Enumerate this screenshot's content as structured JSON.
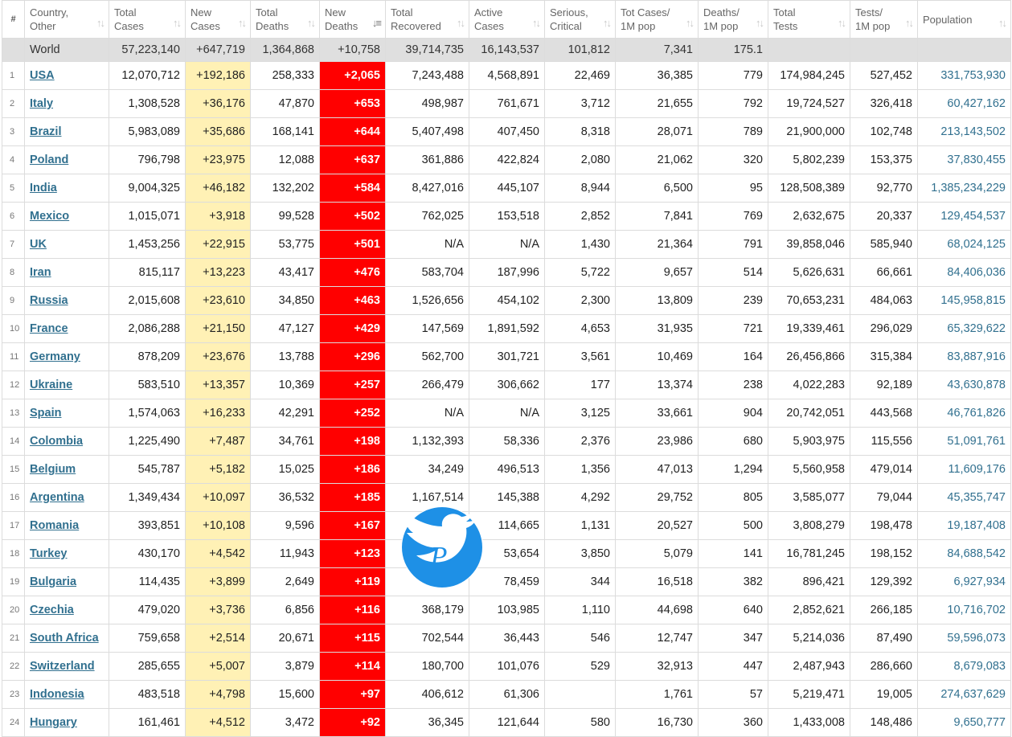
{
  "headers": [
    {
      "key": "num",
      "label": "#"
    },
    {
      "key": "country",
      "label": "Country,\nOther"
    },
    {
      "key": "total_cases",
      "label": "Total\nCases"
    },
    {
      "key": "new_cases",
      "label": "New\nCases"
    },
    {
      "key": "total_deaths",
      "label": "Total\nDeaths"
    },
    {
      "key": "new_deaths",
      "label": "New\nDeaths",
      "sorted": true
    },
    {
      "key": "total_recovered",
      "label": "Total\nRecovered"
    },
    {
      "key": "active_cases",
      "label": "Active\nCases"
    },
    {
      "key": "serious",
      "label": "Serious,\nCritical"
    },
    {
      "key": "cases_per_m",
      "label": "Tot Cases/\n1M pop"
    },
    {
      "key": "deaths_per_m",
      "label": "Deaths/\n1M pop"
    },
    {
      "key": "total_tests",
      "label": "Total\nTests"
    },
    {
      "key": "tests_per_m",
      "label": "Tests/\n1M pop"
    },
    {
      "key": "population",
      "label": "Population"
    }
  ],
  "world": [
    "World",
    "57,223,140",
    "+647,719",
    "1,364,868",
    "+10,758",
    "39,714,735",
    "16,143,537",
    "101,812",
    "7,341",
    "175.1",
    "",
    "",
    ""
  ],
  "rows": [
    [
      "1",
      "USA",
      "12,070,712",
      "+192,186",
      "258,333",
      "+2,065",
      "7,243,488",
      "4,568,891",
      "22,469",
      "36,385",
      "779",
      "174,984,245",
      "527,452",
      "331,753,930"
    ],
    [
      "2",
      "Italy",
      "1,308,528",
      "+36,176",
      "47,870",
      "+653",
      "498,987",
      "761,671",
      "3,712",
      "21,655",
      "792",
      "19,724,527",
      "326,418",
      "60,427,162"
    ],
    [
      "3",
      "Brazil",
      "5,983,089",
      "+35,686",
      "168,141",
      "+644",
      "5,407,498",
      "407,450",
      "8,318",
      "28,071",
      "789",
      "21,900,000",
      "102,748",
      "213,143,502"
    ],
    [
      "4",
      "Poland",
      "796,798",
      "+23,975",
      "12,088",
      "+637",
      "361,886",
      "422,824",
      "2,080",
      "21,062",
      "320",
      "5,802,239",
      "153,375",
      "37,830,455"
    ],
    [
      "5",
      "India",
      "9,004,325",
      "+46,182",
      "132,202",
      "+584",
      "8,427,016",
      "445,107",
      "8,944",
      "6,500",
      "95",
      "128,508,389",
      "92,770",
      "1,385,234,229"
    ],
    [
      "6",
      "Mexico",
      "1,015,071",
      "+3,918",
      "99,528",
      "+502",
      "762,025",
      "153,518",
      "2,852",
      "7,841",
      "769",
      "2,632,675",
      "20,337",
      "129,454,537"
    ],
    [
      "7",
      "UK",
      "1,453,256",
      "+22,915",
      "53,775",
      "+501",
      "N/A",
      "N/A",
      "1,430",
      "21,364",
      "791",
      "39,858,046",
      "585,940",
      "68,024,125"
    ],
    [
      "8",
      "Iran",
      "815,117",
      "+13,223",
      "43,417",
      "+476",
      "583,704",
      "187,996",
      "5,722",
      "9,657",
      "514",
      "5,626,631",
      "66,661",
      "84,406,036"
    ],
    [
      "9",
      "Russia",
      "2,015,608",
      "+23,610",
      "34,850",
      "+463",
      "1,526,656",
      "454,102",
      "2,300",
      "13,809",
      "239",
      "70,653,231",
      "484,063",
      "145,958,815"
    ],
    [
      "10",
      "France",
      "2,086,288",
      "+21,150",
      "47,127",
      "+429",
      "147,569",
      "1,891,592",
      "4,653",
      "31,935",
      "721",
      "19,339,461",
      "296,029",
      "65,329,622"
    ],
    [
      "11",
      "Germany",
      "878,209",
      "+23,676",
      "13,788",
      "+296",
      "562,700",
      "301,721",
      "3,561",
      "10,469",
      "164",
      "26,456,866",
      "315,384",
      "83,887,916"
    ],
    [
      "12",
      "Ukraine",
      "583,510",
      "+13,357",
      "10,369",
      "+257",
      "266,479",
      "306,662",
      "177",
      "13,374",
      "238",
      "4,022,283",
      "92,189",
      "43,630,878"
    ],
    [
      "13",
      "Spain",
      "1,574,063",
      "+16,233",
      "42,291",
      "+252",
      "N/A",
      "N/A",
      "3,125",
      "33,661",
      "904",
      "20,742,051",
      "443,568",
      "46,761,826"
    ],
    [
      "14",
      "Colombia",
      "1,225,490",
      "+7,487",
      "34,761",
      "+198",
      "1,132,393",
      "58,336",
      "2,376",
      "23,986",
      "680",
      "5,903,975",
      "115,556",
      "51,091,761"
    ],
    [
      "15",
      "Belgium",
      "545,787",
      "+5,182",
      "15,025",
      "+186",
      "34,249",
      "496,513",
      "1,356",
      "47,013",
      "1,294",
      "5,560,958",
      "479,014",
      "11,609,176"
    ],
    [
      "16",
      "Argentina",
      "1,349,434",
      "+10,097",
      "36,532",
      "+185",
      "1,167,514",
      "145,388",
      "4,292",
      "29,752",
      "805",
      "3,585,077",
      "79,044",
      "45,355,747"
    ],
    [
      "17",
      "Romania",
      "393,851",
      "+10,108",
      "9,596",
      "+167",
      "",
      "114,665",
      "1,131",
      "20,527",
      "500",
      "3,808,279",
      "198,478",
      "19,187,408"
    ],
    [
      "18",
      "Turkey",
      "430,170",
      "+4,542",
      "11,943",
      "+123",
      "",
      "53,654",
      "3,850",
      "5,079",
      "141",
      "16,781,245",
      "198,152",
      "84,688,542"
    ],
    [
      "19",
      "Bulgaria",
      "114,435",
      "+3,899",
      "2,649",
      "+119",
      "",
      "78,459",
      "344",
      "16,518",
      "382",
      "896,421",
      "129,392",
      "6,927,934"
    ],
    [
      "20",
      "Czechia",
      "479,020",
      "+3,736",
      "6,856",
      "+116",
      "368,179",
      "103,985",
      "1,110",
      "44,698",
      "640",
      "2,852,621",
      "266,185",
      "10,716,702"
    ],
    [
      "21",
      "South Africa",
      "759,658",
      "+2,514",
      "20,671",
      "+115",
      "702,544",
      "36,443",
      "546",
      "12,747",
      "347",
      "5,214,036",
      "87,490",
      "59,596,073"
    ],
    [
      "22",
      "Switzerland",
      "285,655",
      "+5,007",
      "3,879",
      "+114",
      "180,700",
      "101,076",
      "529",
      "32,913",
      "447",
      "2,487,943",
      "286,660",
      "8,679,083"
    ],
    [
      "23",
      "Indonesia",
      "483,518",
      "+4,798",
      "15,600",
      "+97",
      "406,612",
      "61,306",
      "",
      "1,761",
      "57",
      "5,219,471",
      "19,005",
      "274,637,629"
    ],
    [
      "24",
      "Hungary",
      "161,461",
      "+4,512",
      "3,472",
      "+92",
      "36,345",
      "121,644",
      "580",
      "16,730",
      "360",
      "1,433,008",
      "148,486",
      "9,650,777"
    ]
  ],
  "colors": {
    "new_cases_bg": "#fff1b5",
    "new_deaths_bg": "#ff0000",
    "link": "#31708f",
    "world_bg": "#dfdfdf",
    "logo_blue": "#1e90e6"
  },
  "icons": {
    "sort": "sort-arrows-icon",
    "logo": "twitter-bird-watermark-icon"
  }
}
